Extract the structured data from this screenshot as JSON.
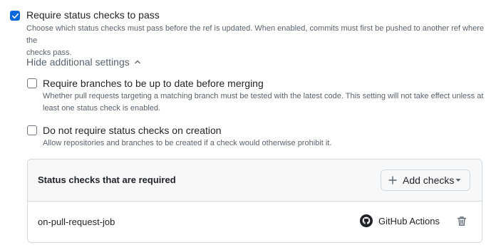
{
  "require_status": {
    "checked": true,
    "label": "Require status checks to pass",
    "description_line1": "Choose which status checks must pass before the ref is updated. When enabled, commits must first be pushed to another ref where the",
    "description_line2": "checks pass."
  },
  "toggle": {
    "label": "Hide additional settings",
    "icon": "chevron-up-icon"
  },
  "up_to_date": {
    "checked": false,
    "label": "Require branches to be up to date before merging",
    "description_line1": "Whether pull requests targeting a matching branch must be tested with the latest code. This setting will not take effect unless at",
    "description_line2": "least one status check is enabled."
  },
  "no_creation": {
    "checked": false,
    "label": "Do not require status checks on creation",
    "description": "Allow repositories and branches to be created if a check would otherwise prohibit it."
  },
  "required_checks": {
    "title": "Status checks that are required",
    "add_button": "Add checks",
    "rows": [
      {
        "name": "on-pull-request-job",
        "provider": "GitHub Actions"
      }
    ]
  },
  "colors": {
    "accent": "#0969da",
    "muted_text": "#59636e",
    "border": "#d1d9e0"
  }
}
